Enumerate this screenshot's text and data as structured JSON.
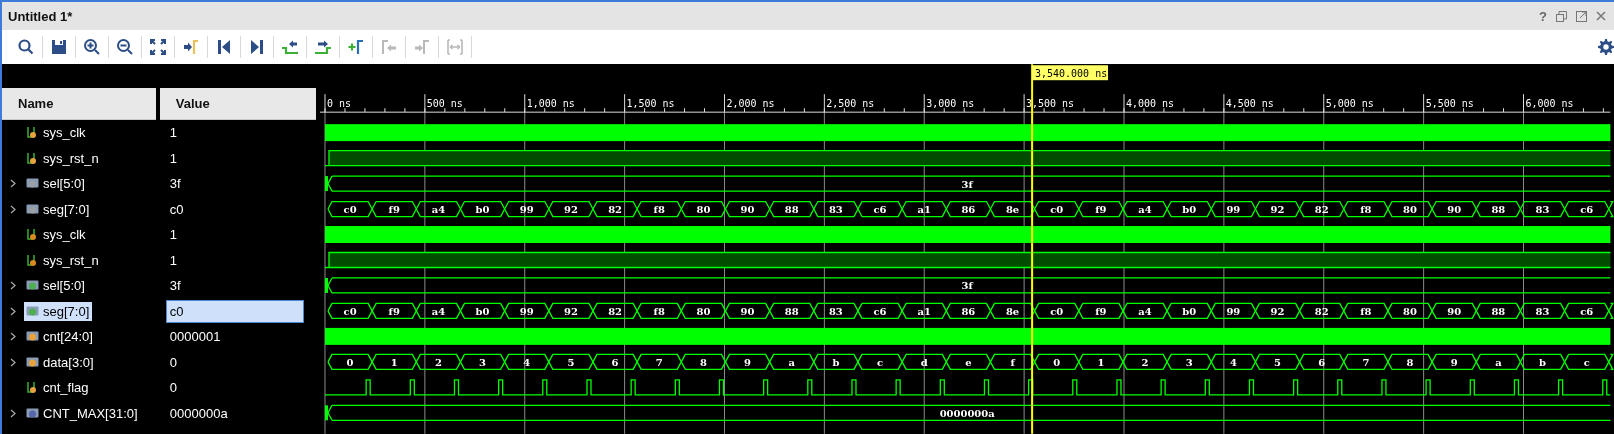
{
  "window": {
    "title": "Untitled 1*",
    "help": "?"
  },
  "toolbar": [
    {
      "kind": "search",
      "disabled": false
    },
    {
      "kind": "save",
      "disabled": false
    },
    {
      "kind": "zoom-in",
      "disabled": false
    },
    {
      "kind": "zoom-out",
      "disabled": false
    },
    {
      "kind": "zoom-fit",
      "disabled": false
    },
    {
      "kind": "go-to-cursor",
      "disabled": false
    },
    {
      "kind": "go-to-start",
      "disabled": false
    },
    {
      "kind": "go-to-end",
      "disabled": false
    },
    {
      "kind": "previous-transition",
      "disabled": false
    },
    {
      "kind": "next-transition",
      "disabled": false
    },
    {
      "kind": "add-marker",
      "disabled": false
    },
    {
      "kind": "previous-marker",
      "disabled": true
    },
    {
      "kind": "next-marker",
      "disabled": true
    },
    {
      "kind": "swap-cursors",
      "disabled": true
    }
  ],
  "columns": [
    "Name",
    "Value"
  ],
  "ruler": [
    "0 ns",
    "500 ns",
    "1,000 ns",
    "1,500 ns",
    "2,000 ns",
    "2,500 ns",
    "3,000 ns",
    "3,500 ns",
    "4,000 ns",
    "4,500 ns",
    "5,000 ns",
    "5,500 ns",
    "6,000 ns"
  ],
  "cursor": {
    "label": "3,540.000 ns"
  },
  "signals": [
    {
      "name": "sys_clk",
      "value": "1",
      "kind": "bit",
      "color": "#e8a33c",
      "selected": false,
      "wave": {
        "kind": "dense"
      }
    },
    {
      "name": "sys_rst_n",
      "value": "1",
      "kind": "bit",
      "color": "#e8a33c",
      "selected": false,
      "wave": {
        "kind": "reset"
      }
    },
    {
      "name": "sel[5:0]",
      "value": "3f",
      "kind": "bus",
      "color": "#9aa0a6",
      "expanded": false,
      "selected": false,
      "wave": {
        "kind": "bus",
        "segments": [
          "3f"
        ]
      }
    },
    {
      "name": "seg[7:0]",
      "value": "c0",
      "kind": "bus",
      "color": "#9aa0a6",
      "expanded": false,
      "selected": false,
      "wave": {
        "kind": "bus",
        "segments": [
          "c0",
          "f9",
          "a4",
          "b0",
          "99",
          "92",
          "82",
          "f8",
          "80",
          "90",
          "88",
          "83",
          "c6",
          "a1",
          "86",
          "8e",
          "c0",
          "f9",
          "a4",
          "b0",
          "99",
          "92",
          "82",
          "f8",
          "80",
          "90",
          "88",
          "83",
          "c6"
        ]
      }
    },
    {
      "name": "sys_clk",
      "value": "1",
      "kind": "bit",
      "color": "#d98a1f",
      "selected": false,
      "wave": {
        "kind": "dense"
      }
    },
    {
      "name": "sys_rst_n",
      "value": "1",
      "kind": "bit",
      "color": "#d98a1f",
      "selected": false,
      "wave": {
        "kind": "reset"
      }
    },
    {
      "name": "sel[5:0]",
      "value": "3f",
      "kind": "bus",
      "color": "#4caf50",
      "expanded": false,
      "selected": false,
      "wave": {
        "kind": "bus",
        "segments": [
          "3f"
        ]
      }
    },
    {
      "name": "seg[7:0]",
      "value": "c0",
      "kind": "bus",
      "color": "#4caf50",
      "expanded": false,
      "selected": true,
      "wave": {
        "kind": "bus",
        "segments": [
          "c0",
          "f9",
          "a4",
          "b0",
          "99",
          "92",
          "82",
          "f8",
          "80",
          "90",
          "88",
          "83",
          "c6",
          "a1",
          "86",
          "8e",
          "c0",
          "f9",
          "a4",
          "b0",
          "99",
          "92",
          "82",
          "f8",
          "80",
          "90",
          "88",
          "83",
          "c6"
        ]
      }
    },
    {
      "name": "cnt[24:0]",
      "value": "0000001",
      "kind": "bus",
      "color": "#e8a33c",
      "expanded": false,
      "selected": false,
      "wave": {
        "kind": "dense"
      }
    },
    {
      "name": "data[3:0]",
      "value": "0",
      "kind": "bus",
      "color": "#e8a33c",
      "expanded": false,
      "selected": false,
      "wave": {
        "kind": "bus",
        "segments": [
          "0",
          "1",
          "2",
          "3",
          "4",
          "5",
          "6",
          "7",
          "8",
          "9",
          "a",
          "b",
          "c",
          "d",
          "e",
          "f",
          "0",
          "1",
          "2",
          "3",
          "4",
          "5",
          "6",
          "7",
          "8",
          "9",
          "a",
          "b",
          "c"
        ]
      }
    },
    {
      "name": "cnt_flag",
      "value": "0",
      "kind": "bit",
      "color": "#e8a33c",
      "selected": false,
      "wave": {
        "kind": "pulse"
      }
    },
    {
      "name": "CNT_MAX[31:0]",
      "value": "0000000a",
      "kind": "bus",
      "color": "#5566aa",
      "expanded": false,
      "selected": false,
      "wave": {
        "kind": "bus",
        "segments": [
          "0000000a"
        ]
      }
    }
  ]
}
